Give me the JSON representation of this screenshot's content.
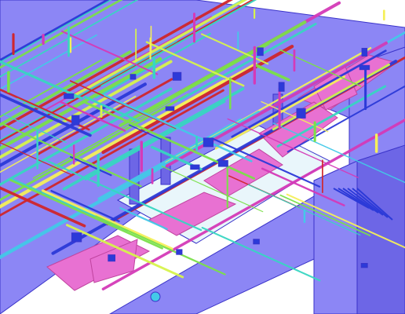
{
  "scene": {
    "kind": "isometric MEP coordination model",
    "palette": {
      "structure": "#8c86f5",
      "structure_dark": "#6d66e6",
      "structure_edge": "#3a33c9",
      "slab_light": "#e9f6fb",
      "duct_pink": "#e871d2",
      "duct_pink_dark": "#c0449f",
      "pipe_green": "#7be04a",
      "pipe_lime": "#d7f44c",
      "pipe_yellow": "#f5f05a",
      "pipe_teal": "#38d6c2",
      "pipe_cyan": "#43c9e8",
      "pipe_red": "#d0262c",
      "pipe_blue": "#2c3ad8",
      "pipe_magenta": "#d43ab8"
    },
    "icons": [
      "building-wall",
      "column",
      "duct",
      "pipe"
    ]
  }
}
